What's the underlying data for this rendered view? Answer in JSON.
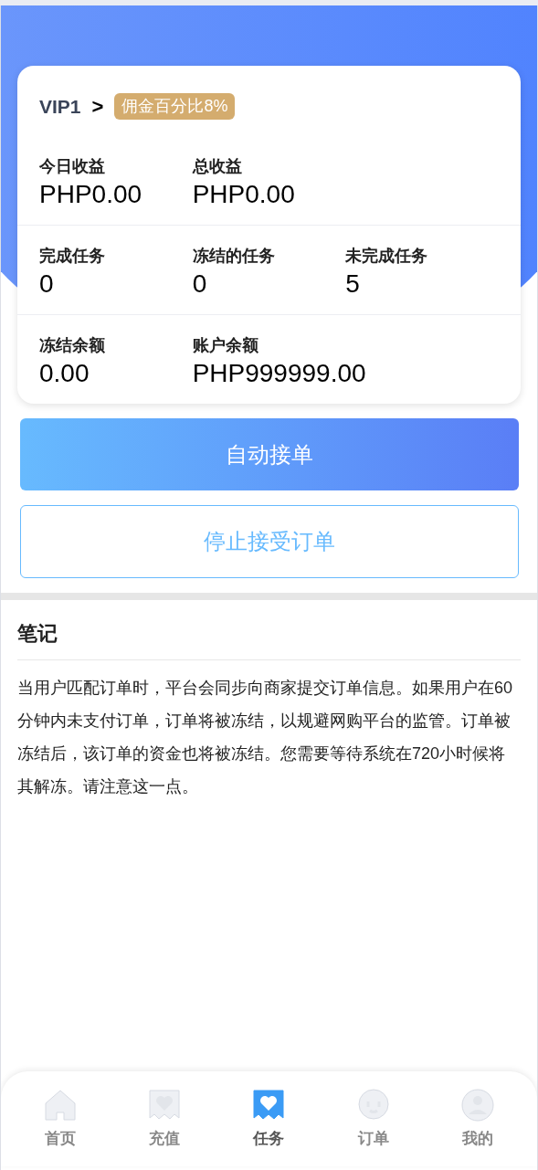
{
  "vip": {
    "level": "VIP1",
    "arrow": ">",
    "commission": "佣金百分比8%"
  },
  "stats": [
    [
      {
        "label": "今日收益",
        "value": "PHP0.00"
      },
      {
        "label": "总收益",
        "value": "PHP0.00"
      }
    ],
    [
      {
        "label": "完成任务",
        "value": "0"
      },
      {
        "label": "冻结的任务",
        "value": "0"
      },
      {
        "label": "未完成任务",
        "value": "5"
      }
    ],
    [
      {
        "label": "冻结余额",
        "value": "0.00"
      },
      {
        "label": "账户余额",
        "value": "PHP999999.00"
      }
    ]
  ],
  "buttons": {
    "auto": "自动接单",
    "stop": "停止接受订单"
  },
  "notes": {
    "title": "笔记",
    "text": "当用户匹配订单时，平台会同步向商家提交订单信息。如果用户在60分钟内未支付订单，订单将被冻结，以规避网购平台的监管。订单被冻结后，该订单的资金也将被冻结。您需要等待系统在720小时候将其解冻。请注意这一点。"
  },
  "nav": [
    {
      "label": "首页",
      "selected": false
    },
    {
      "label": "充值",
      "selected": false
    },
    {
      "label": "任务",
      "selected": true
    },
    {
      "label": "订单",
      "selected": false
    },
    {
      "label": "我的",
      "selected": false
    }
  ]
}
